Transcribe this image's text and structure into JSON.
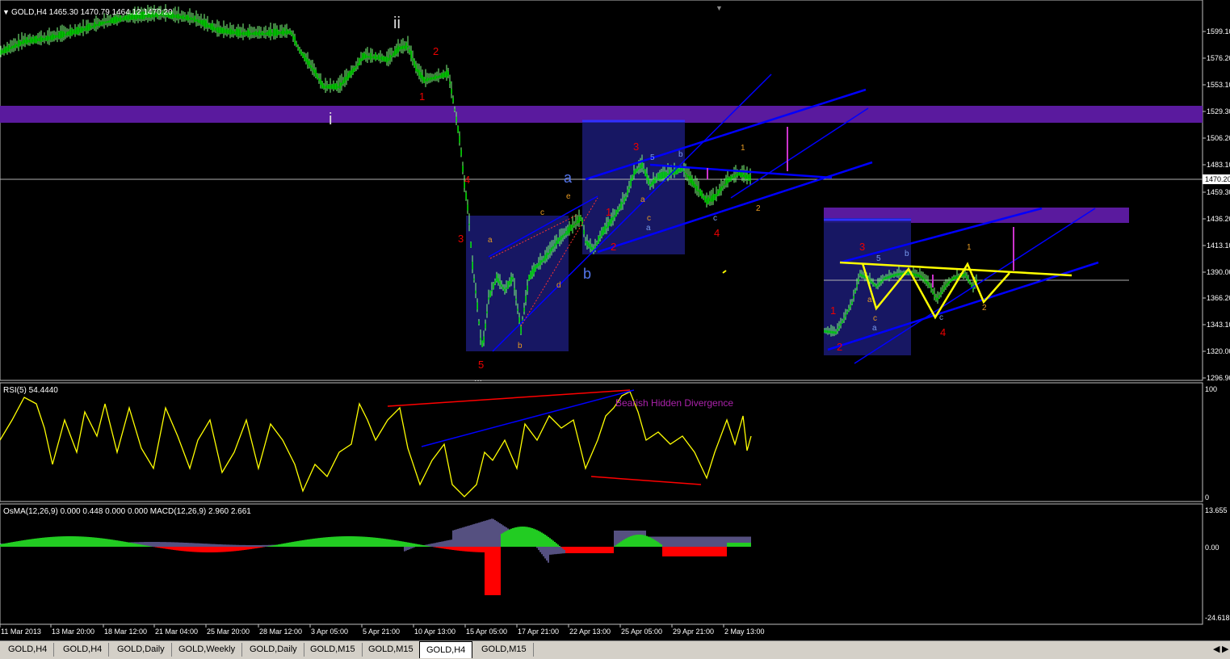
{
  "main_chart": {
    "header": "GOLD,H4  1465.30 1470.79 1464.12 1470.20",
    "price_axis": [
      "1599.10",
      "1576.20",
      "1553.10",
      "1529.30",
      "1506.20",
      "1483.10",
      "1470.20",
      "1459.30",
      "1436.20",
      "1413.10",
      "1390.00",
      "1366.20",
      "1343.10",
      "1320.00",
      "1296.90"
    ],
    "current_price": "1470.20",
    "wave_labels": {
      "ii": "ii",
      "i": "i",
      "r2": "2",
      "r1": "1",
      "r4": "4",
      "r3": "3",
      "r5": "5",
      "a_big": "a",
      "b_big": "b",
      "o_a": "a",
      "o_b": "b",
      "o_c": "c",
      "o_d": "d",
      "o_e": "e",
      "b1": "1",
      "b2": "2",
      "b3": "3",
      "b4": "4",
      "s5": "5",
      "sb": "b",
      "sa": "a",
      "sc": "c",
      "sc2": "c",
      "sa2": "a",
      "o1": "1",
      "o2": "2",
      "dots": "..."
    },
    "projection_labels": {
      "p1": "1",
      "p2": "2",
      "p3": "3",
      "p4": "4",
      "p_5": "5",
      "p_b": "b",
      "p_a": "a",
      "p_c": "c",
      "p_a2": "a",
      "p_c2": "c",
      "p_o1": "1",
      "p_o2": "2"
    }
  },
  "rsi": {
    "label": "RSI(5) 54.4440",
    "axis_top": "100",
    "axis_bottom": "0",
    "annotation": "Bearish Hidden Divergence"
  },
  "macd": {
    "label": "OsMA(12,26,9) 0.000 0.448 0.000 0.000   MACD(12,26,9) 2.960 2.661",
    "axis": [
      "13.655",
      "0.00",
      "-24.618"
    ]
  },
  "time_axis": [
    "11 Mar 2013",
    "13 Mar 20:00",
    "18 Mar 12:00",
    "21 Mar 04:00",
    "25 Mar 20:00",
    "28 Mar 12:00",
    "3 Apr 05:00",
    "5 Apr 21:00",
    "10 Apr 13:00",
    "15 Apr 05:00",
    "17 Apr 21:00",
    "22 Apr 13:00",
    "25 Apr 05:00",
    "29 Apr 21:00",
    "2 May 13:00"
  ],
  "tabs": [
    "GOLD,H4",
    "GOLD,H4",
    "GOLD,Daily",
    "GOLD,Weekly",
    "GOLD,Daily",
    "GOLD,M15",
    "GOLD,M15",
    "GOLD,H4",
    "GOLD,M15"
  ],
  "active_tab_index": 7,
  "colors": {
    "candle_up": "#00ff00",
    "wick": "#7fff7f",
    "zone": "#5a1a9e",
    "box": "#1a1a6e",
    "channel": "#0000ff",
    "rsi_line": "#ffff00",
    "divergence_red": "#ff0000",
    "osma_pos": "#22cc22",
    "osma_neg": "#ff0000",
    "macd_bars": "#aaa0ff"
  }
}
